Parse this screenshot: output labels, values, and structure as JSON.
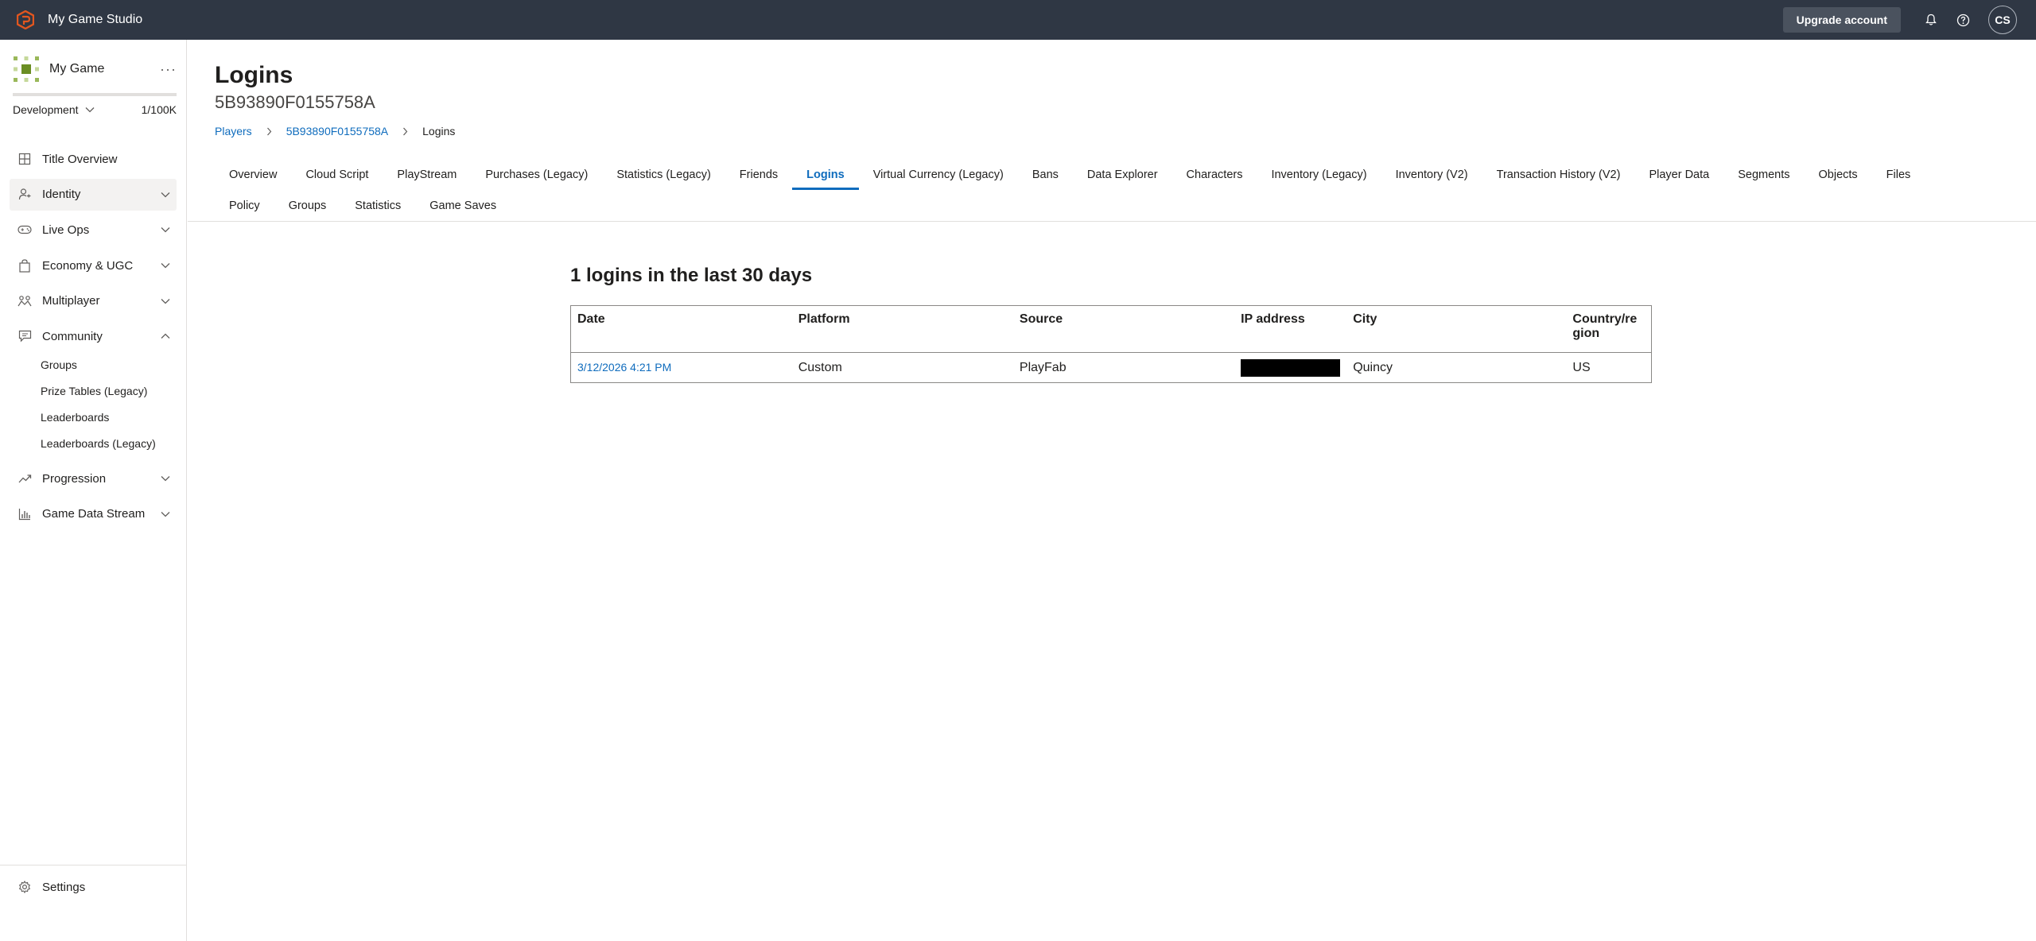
{
  "topbar": {
    "studio_name": "My Game Studio",
    "upgrade_label": "Upgrade account",
    "avatar_initials": "CS",
    "brand_color": "#e2561f"
  },
  "sidebar": {
    "game_name": "My Game",
    "more_label": "···",
    "environment": "Development",
    "quota": "1/100K",
    "quota_fraction": 1e-05,
    "items": [
      {
        "label": "Title Overview",
        "icon": "grid-icon",
        "expandable": false
      },
      {
        "label": "Identity",
        "icon": "people-icon",
        "expandable": true,
        "active": true
      },
      {
        "label": "Live Ops",
        "icon": "gamepad-icon",
        "expandable": true
      },
      {
        "label": "Economy & UGC",
        "icon": "shopping-bag-icon",
        "expandable": true
      },
      {
        "label": "Multiplayer",
        "icon": "multiplayer-icon",
        "expandable": true
      },
      {
        "label": "Community",
        "icon": "chat-icon",
        "expandable": true,
        "expanded": true
      },
      {
        "label": "Progression",
        "icon": "trend-icon",
        "expandable": true
      },
      {
        "label": "Game Data Stream",
        "icon": "bar-chart-icon",
        "expandable": true
      }
    ],
    "community_subitems": [
      "Groups",
      "Prize Tables (Legacy)",
      "Leaderboards",
      "Leaderboards (Legacy)"
    ],
    "settings_label": "Settings"
  },
  "page": {
    "title": "Logins",
    "subtitle": "5B93890F0155758A",
    "breadcrumb": [
      "Players",
      "5B93890F0155758A",
      "Logins"
    ],
    "tabs_row1": [
      "Overview",
      "Cloud Script",
      "PlayStream",
      "Purchases (Legacy)",
      "Statistics (Legacy)",
      "Friends",
      "Logins",
      "Virtual Currency (Legacy)",
      "Bans",
      "Data Explorer",
      "Characters",
      "Inventory (Legacy)",
      "Inventory (V2)",
      "Transaction History (V2)",
      "Player Data",
      "Segments",
      "Objects",
      "Files"
    ],
    "tabs_row2": [
      "Policy",
      "Groups",
      "Statistics",
      "Game Saves"
    ],
    "active_tab": "Logins",
    "logins_heading": "1 logins in the last 30 days"
  },
  "table": {
    "headers": [
      "Date",
      "Platform",
      "Source",
      "IP address",
      "City",
      "Country/region"
    ],
    "header_country_line1": "Country/re",
    "header_country_line2": "gion",
    "rows": [
      {
        "date": "3/12/2026 4:21 PM",
        "platform": "Custom",
        "source": "PlayFab",
        "ip": "",
        "city": "Quincy",
        "country": "US"
      }
    ]
  }
}
